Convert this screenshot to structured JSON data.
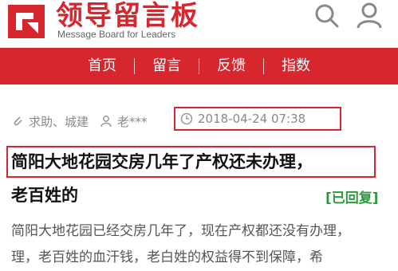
{
  "header": {
    "brand_name": "领导留言板",
    "brand_subtitle": "Message Board for Leaders",
    "icons": [
      "logo-icon",
      "search-icon",
      "user-icon"
    ]
  },
  "nav": {
    "items": [
      {
        "label": "首页"
      },
      {
        "label": "留言"
      },
      {
        "label": "反馈"
      },
      {
        "label": "指数"
      }
    ]
  },
  "post": {
    "category": "求助、城建",
    "author": "老***",
    "timestamp": "2018-04-24 07:38",
    "title_line1": "简阳大地花园交房几年了产权还未办理，",
    "title_line2": "老百姓的",
    "status_badge": "[已回复]",
    "body_line1": "简阳大地花园已经交房几年了，现在产权都还没有办理，",
    "body_line2": "理，老百姓的血汗钱，老白姓的权益得不到保障，希"
  },
  "colors": {
    "accent": "#d6262e",
    "status_green": "#2e9a3e",
    "meta_gray": "#888888"
  }
}
